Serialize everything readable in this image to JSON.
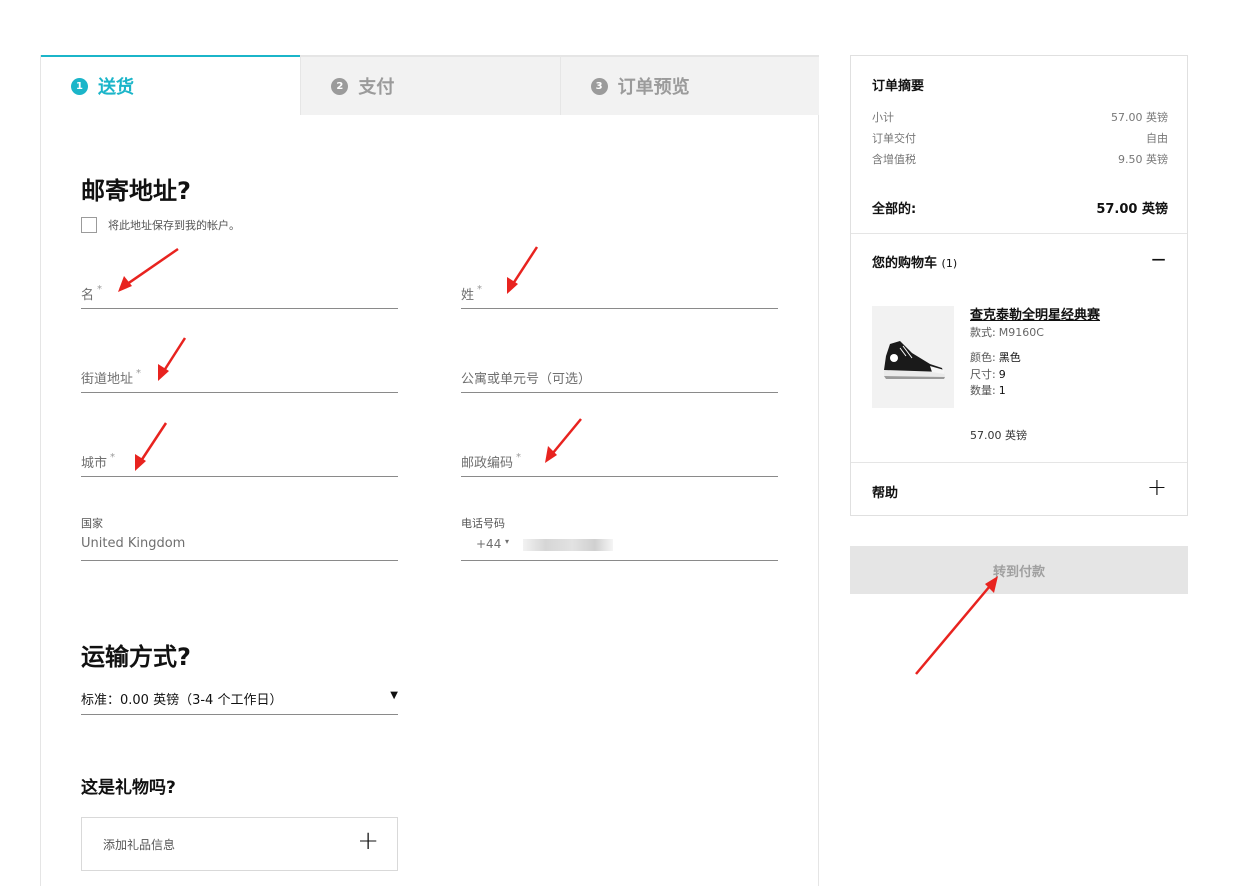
{
  "steps": [
    {
      "num": "1",
      "label": "送货"
    },
    {
      "num": "2",
      "label": "支付"
    },
    {
      "num": "3",
      "label": "订单预览"
    }
  ],
  "address": {
    "title": "邮寄地址?",
    "save_label": "将此地址保存到我的帐户。",
    "first_name": "名",
    "last_name": "姓",
    "street": "街道地址",
    "apartment": "公寓或单元号（可选）",
    "city": "城市",
    "postcode": "邮政编码",
    "required_mark": "*",
    "country_label": "国家",
    "country_value": "United Kingdom",
    "phone_label": "电话号码",
    "phone_code": "+44"
  },
  "shipping": {
    "title": "运输方式?",
    "selected": "标准：0.00 英镑（3-4 个工作日）"
  },
  "gift": {
    "title": "这是礼物吗?",
    "add_label": "添加礼品信息"
  },
  "summary": {
    "title": "订单摘要",
    "rows": [
      {
        "label": "小计",
        "value": "57.00 英镑"
      },
      {
        "label": "订单交付",
        "value": "自由"
      },
      {
        "label": "含增值税",
        "value": "9.50 英镑"
      }
    ],
    "total_label": "全部的:",
    "total_value": "57.00 英镑"
  },
  "cart": {
    "title": "您的购物车",
    "count": "(1)",
    "product": {
      "name": "查克泰勒全明星经典赛",
      "style_label": "款式:",
      "style_value": "M9160C",
      "color_label": "颜色:",
      "color_value": "黑色",
      "size_label": "尺寸:",
      "size_value": "9",
      "qty_label": "数量:",
      "qty_value": "1",
      "price": "57.00 英镑"
    }
  },
  "help": {
    "label": "帮助"
  },
  "checkout": {
    "label": "转到付款"
  },
  "colors": {
    "accent": "#1bb5c9",
    "annotation": "#e8231f",
    "disabled_bg": "#e5e5e5"
  },
  "icons": {
    "plus": "plus-icon",
    "minus": "minus-icon",
    "caret": "caret-down-icon",
    "shoe": "product-shoe-image"
  }
}
